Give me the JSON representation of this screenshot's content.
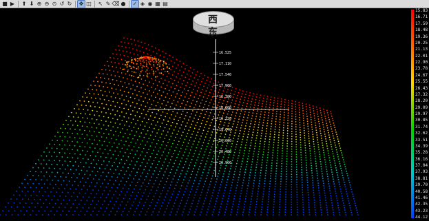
{
  "toolbar": {
    "icons": [
      "arrow-up-icon",
      "arrow-down-icon",
      "zoom-in-icon",
      "zoom-out-icon",
      "zoom-fit-icon",
      "rotate-left-icon",
      "rotate-right-icon",
      "pan-icon",
      "select-icon",
      "measure-icon",
      "pick-icon",
      "erase-icon",
      "point-icon",
      "check-icon",
      "layer-icon",
      "color-icon",
      "grid-icon",
      "chart-icon"
    ]
  },
  "compass": {
    "west": "西",
    "east": "东"
  },
  "axis_labels": [
    "16.525",
    "17.110",
    "17.540",
    "17.960",
    "18.380",
    "18.800",
    "19.220",
    "19.640",
    "20.060",
    "20.480",
    "20.900"
  ],
  "scale": {
    "labels": [
      "15.83",
      "16.71",
      "17.59",
      "18.48",
      "19.36",
      "20.25",
      "21.13",
      "22.01",
      "22.90",
      "23.78",
      "24.67",
      "25.55",
      "26.43",
      "27.32",
      "28.20",
      "29.09",
      "29.97",
      "30.85",
      "31.74",
      "32.62",
      "33.51",
      "34.39",
      "35.28",
      "36.16",
      "37.04",
      "37.93",
      "38.81",
      "39.70",
      "40.58",
      "41.46",
      "42.35",
      "43.23",
      "44.12"
    ]
  }
}
